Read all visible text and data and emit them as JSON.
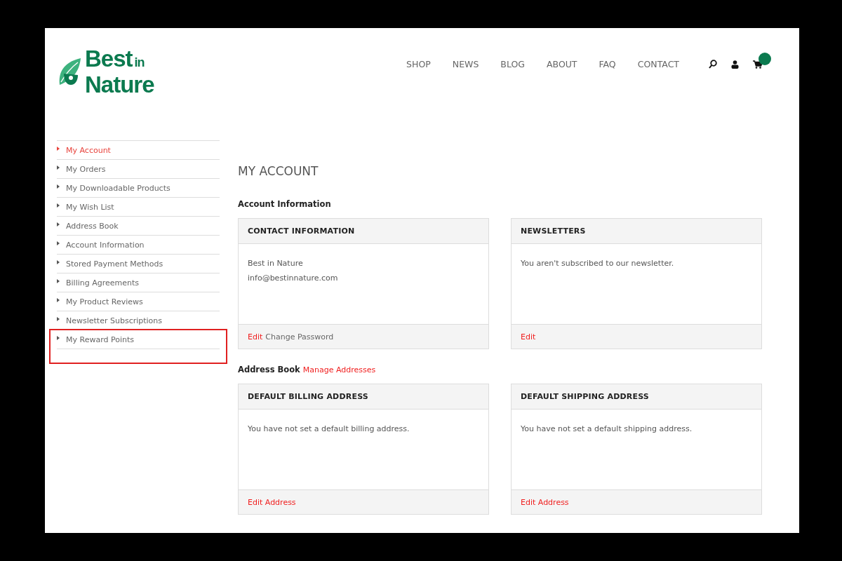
{
  "logo": {
    "word_1": "Best",
    "word_2": "in",
    "word_3": "Nature"
  },
  "nav": {
    "items": [
      "SHOP",
      "NEWS",
      "BLOG",
      "ABOUT",
      "FAQ",
      "CONTACT"
    ]
  },
  "sidebar": {
    "items": [
      {
        "label": "My Account",
        "selected": true,
        "highlighted": false
      },
      {
        "label": "My Orders",
        "selected": false,
        "highlighted": false
      },
      {
        "label": "My Downloadable Products",
        "selected": false,
        "highlighted": false
      },
      {
        "label": "My Wish List",
        "selected": false,
        "highlighted": false
      },
      {
        "label": "Address Book",
        "selected": false,
        "highlighted": false
      },
      {
        "label": "Account Information",
        "selected": false,
        "highlighted": false
      },
      {
        "label": "Stored Payment Methods",
        "selected": false,
        "highlighted": false
      },
      {
        "label": "Billing Agreements",
        "selected": false,
        "highlighted": false
      },
      {
        "label": "My Product Reviews",
        "selected": false,
        "highlighted": false
      },
      {
        "label": "Newsletter Subscriptions",
        "selected": false,
        "highlighted": false
      },
      {
        "label": "My Reward Points",
        "selected": false,
        "highlighted": true
      }
    ]
  },
  "page_title": "MY ACCOUNT",
  "sections": [
    {
      "title": "Account Information",
      "cards": [
        {
          "title": "CONTACT INFORMATION",
          "lines": [
            "Best in Nature",
            "info@bestinnature.com"
          ],
          "links": [
            {
              "label": "Edit",
              "kind": "accent"
            },
            {
              "label": "Change Password",
              "kind": "plain"
            }
          ]
        },
        {
          "title": "NEWSLETTERS",
          "lines": [
            "You aren't subscribed to our newsletter."
          ],
          "links": [
            {
              "label": "Edit",
              "kind": "accent"
            }
          ]
        }
      ]
    },
    {
      "title": "Address Book",
      "link": "Manage Addresses",
      "cards": [
        {
          "title": "DEFAULT BILLING ADDRESS",
          "lines": [
            "You have not set a default billing address."
          ],
          "links": [
            {
              "label": "Edit Address",
              "kind": "accent"
            }
          ]
        },
        {
          "title": "DEFAULT SHIPPING ADDRESS",
          "lines": [
            "You have not set a default shipping address."
          ],
          "links": [
            {
              "label": "Edit Address",
              "kind": "accent"
            }
          ]
        }
      ]
    }
  ]
}
